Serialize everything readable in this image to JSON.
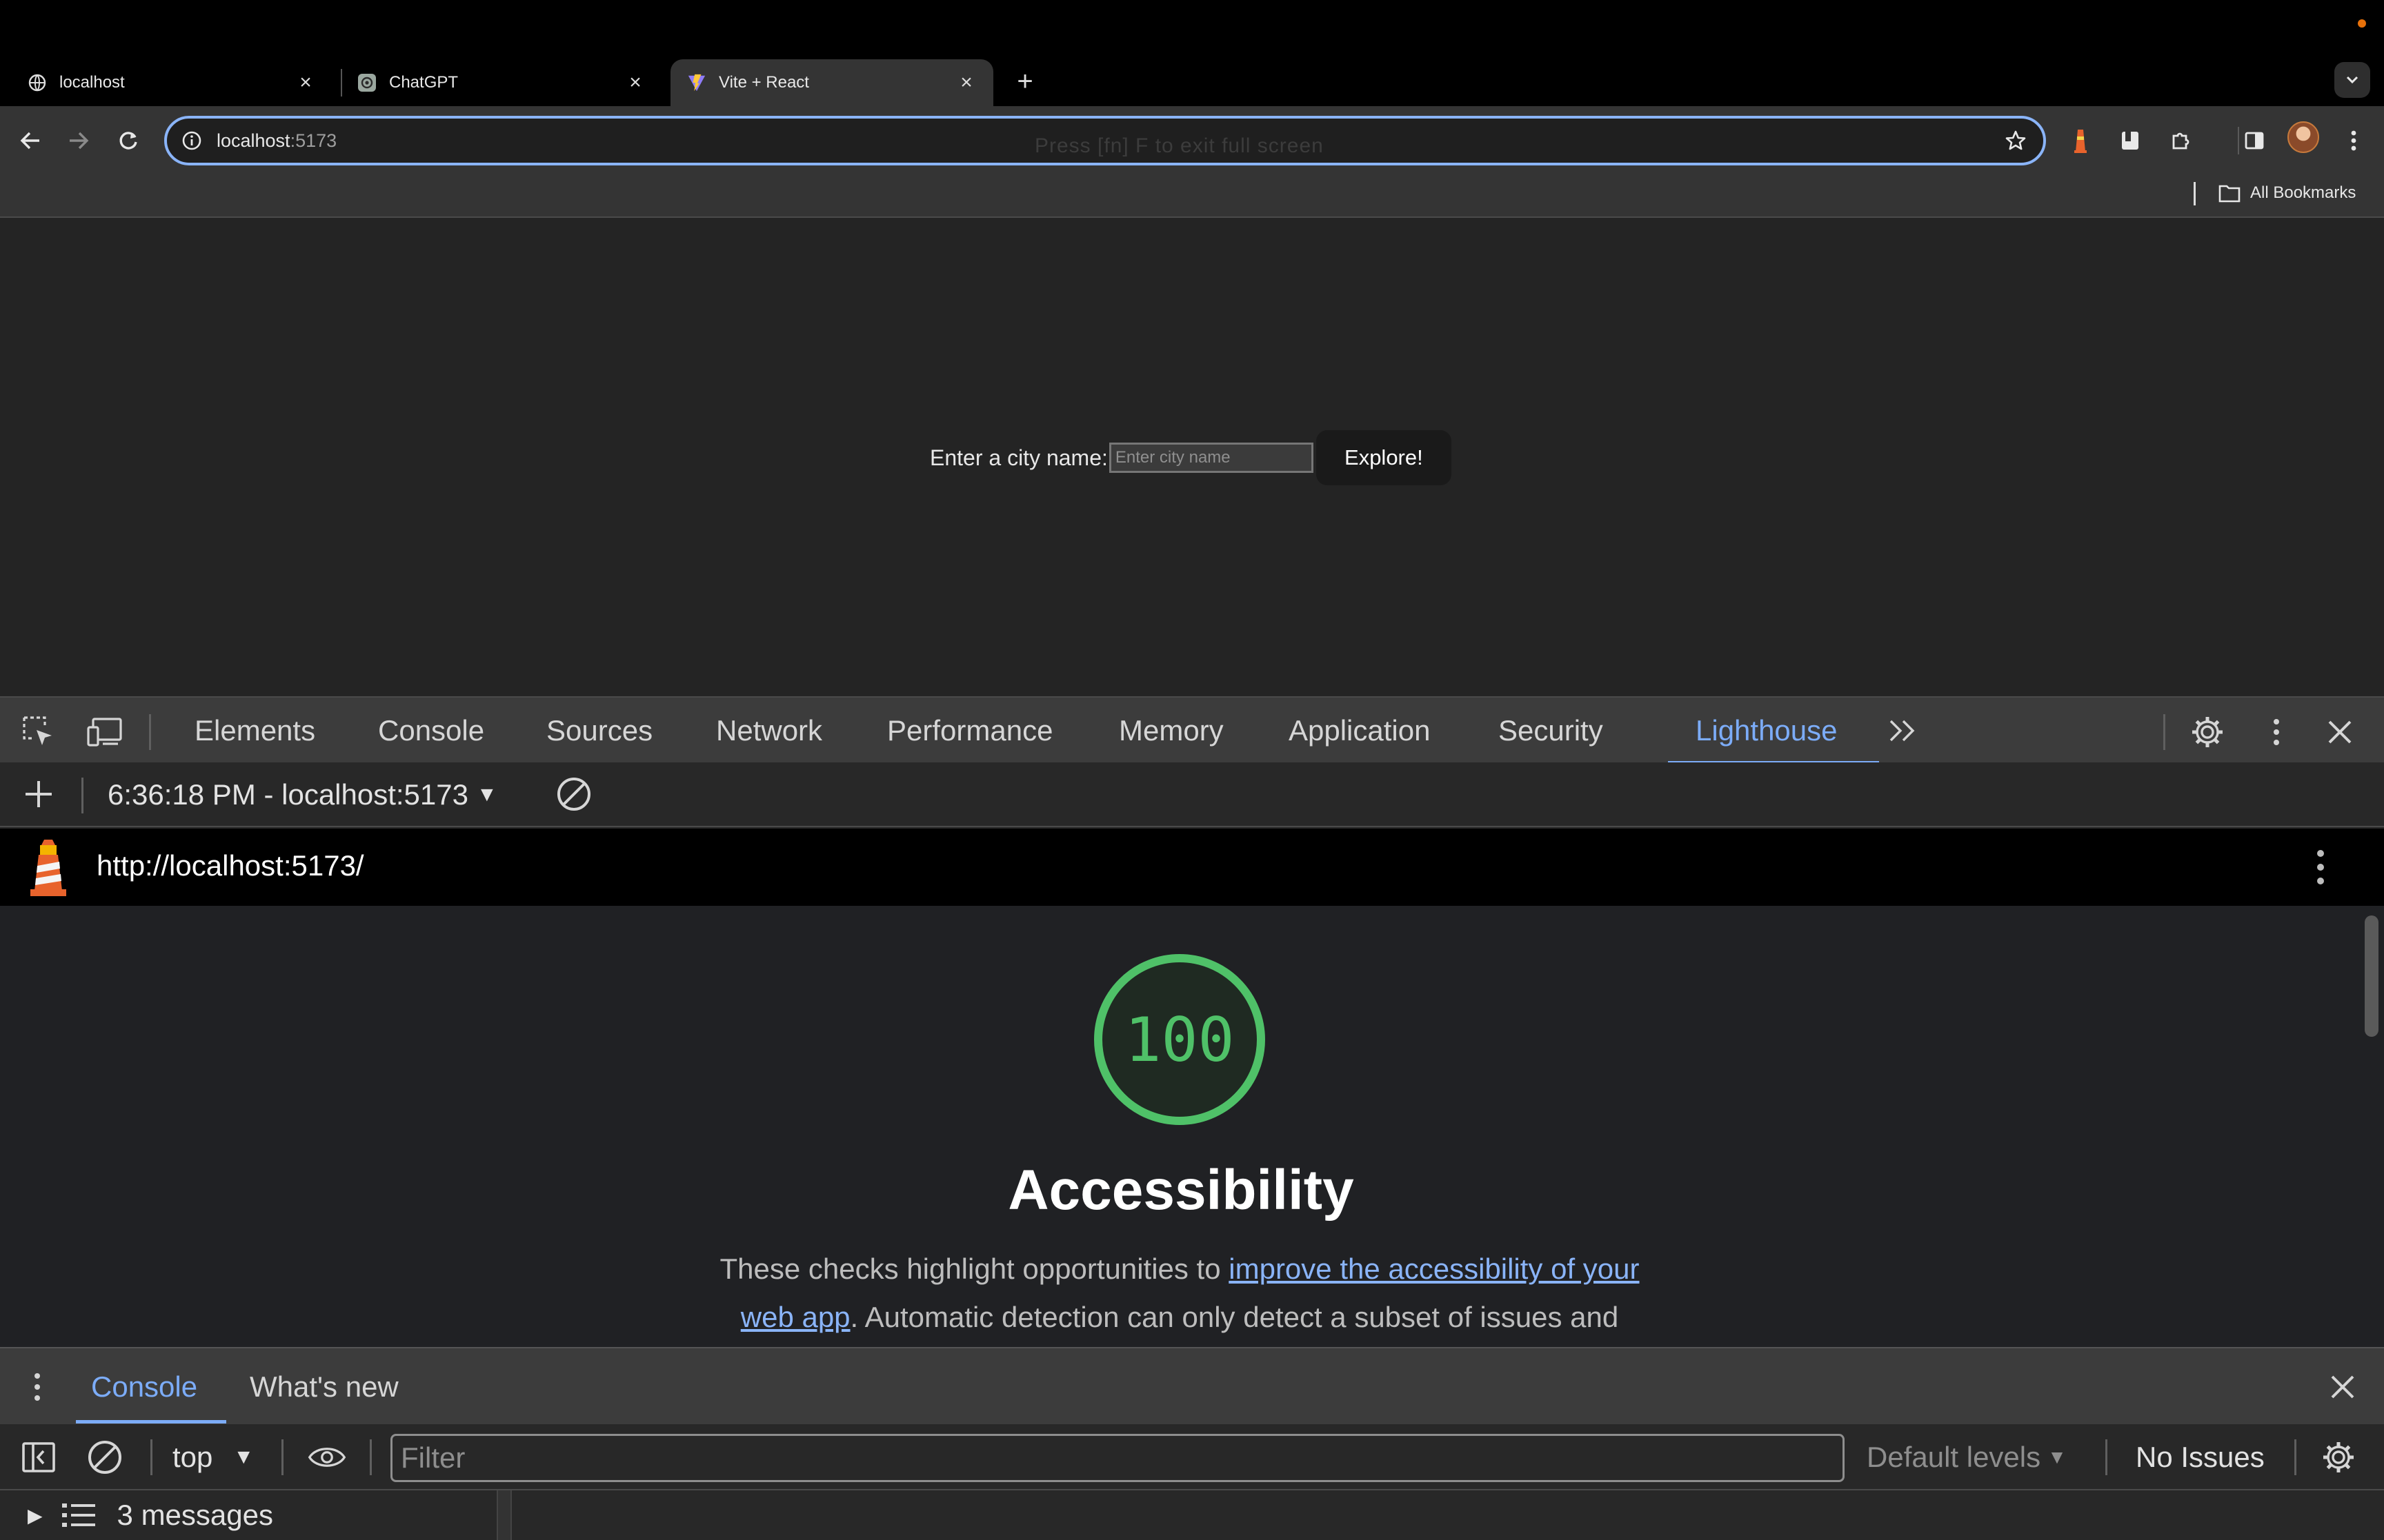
{
  "browser": {
    "tabs": [
      {
        "title": "localhost",
        "icon": "globe-icon",
        "active": false
      },
      {
        "title": "ChatGPT",
        "icon": "chatgpt-icon",
        "active": false
      },
      {
        "title": "Vite + React",
        "icon": "vite-icon",
        "active": true
      }
    ],
    "address": {
      "host": "localhost",
      "port": ":5173"
    },
    "fullscreen_hint": "Press  [fn] F  to exit full screen",
    "bookmarks_label": "All Bookmarks"
  },
  "page": {
    "city_label": "Enter a city name:",
    "city_placeholder": "Enter city name",
    "explore_button": "Explore!"
  },
  "devtools": {
    "tabs": [
      "Elements",
      "Console",
      "Sources",
      "Network",
      "Performance",
      "Memory",
      "Application",
      "Security",
      "Lighthouse"
    ],
    "active_tab": "Lighthouse",
    "lighthouse": {
      "run_label": "6:36:18 PM - localhost:5173",
      "report_url": "http://localhost:5173/",
      "score": "100",
      "category": "Accessibility",
      "desc_before": "These checks highlight opportunities to ",
      "desc_link": "improve the accessibility of your web app",
      "desc_after": ". Automatic detection can only detect a subset of issues and"
    },
    "drawer": {
      "tabs": [
        "Console",
        "What's new"
      ],
      "context": "top",
      "filter_placeholder": "Filter",
      "levels": "Default levels",
      "issues": "No Issues",
      "messages": "3 messages"
    }
  },
  "colors": {
    "accent": "#7cacf8",
    "score_green": "#4fc168",
    "link": "#8ab4f8"
  }
}
